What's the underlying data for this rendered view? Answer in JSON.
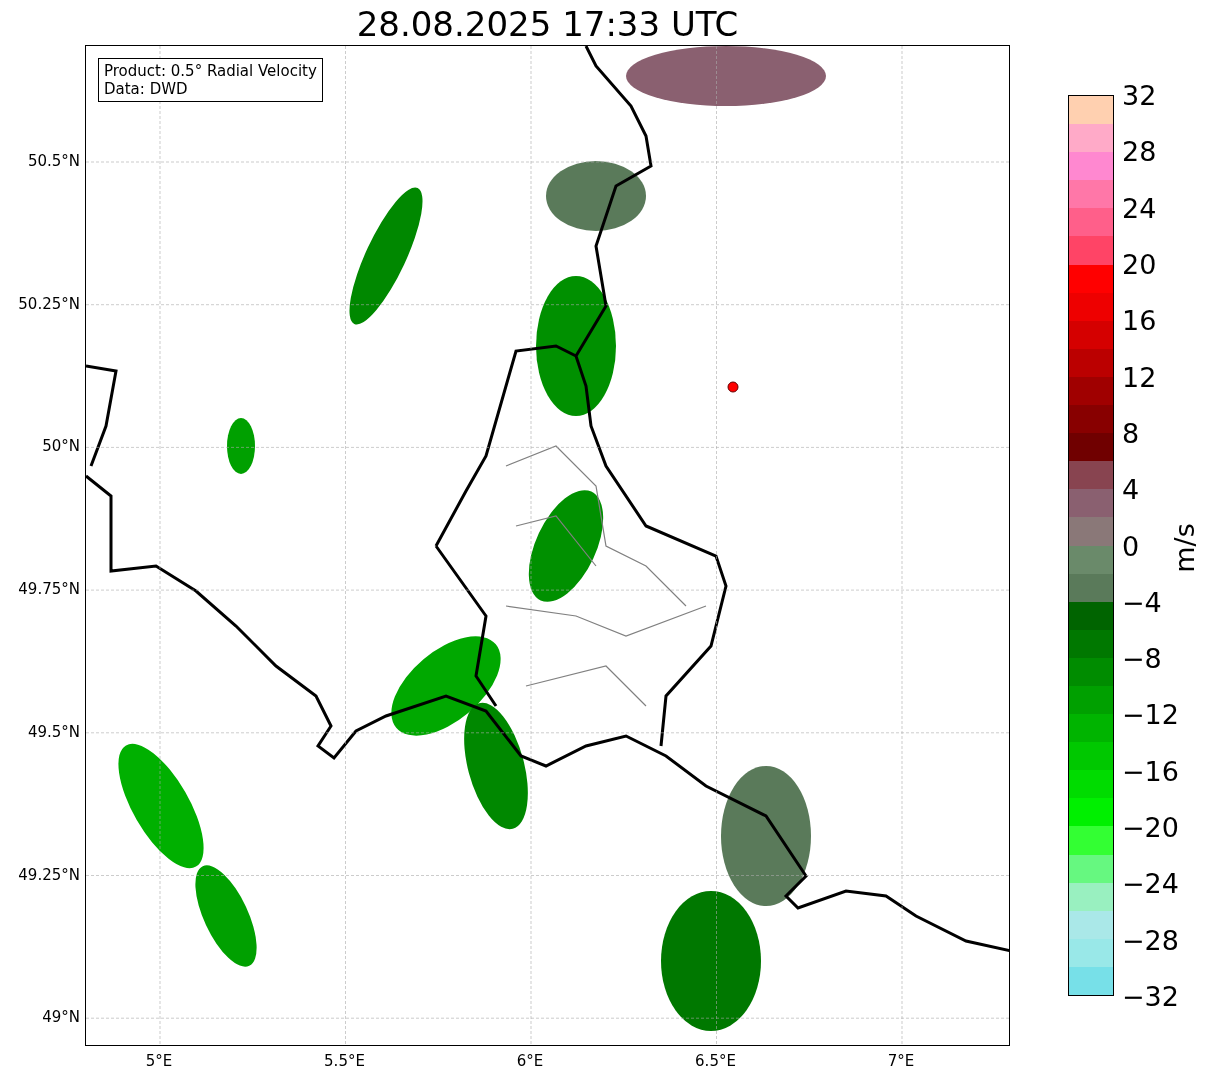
{
  "title": "28.08.2025 17:33 UTC",
  "info_box": {
    "lines": [
      "Product: 0.5° Radial Velocity",
      "Data: DWD"
    ]
  },
  "map": {
    "xticks": [
      "5°E",
      "5.5°E",
      "6°E",
      "6.5°E",
      "7°E"
    ],
    "yticks": [
      "50.5°N",
      "50.25°N",
      "50°N",
      "49.75°N",
      "49.5°N",
      "49.25°N",
      "49°N"
    ]
  },
  "colorbar": {
    "label": "m/s",
    "ticks": [
      "32",
      "28",
      "24",
      "20",
      "16",
      "12",
      "8",
      "4",
      "0",
      "−4",
      "−8",
      "−12",
      "−16",
      "−20",
      "−24",
      "−28",
      "−32"
    ],
    "segments": [
      {
        "color": "#ffd0b0"
      },
      {
        "color": "#ffaac8"
      },
      {
        "color": "#ff88d0"
      },
      {
        "color": "#ff77a8"
      },
      {
        "color": "#ff5f8a"
      },
      {
        "color": "#ff4466"
      },
      {
        "color": "#ff0000"
      },
      {
        "color": "#ee0000"
      },
      {
        "color": "#d50000"
      },
      {
        "color": "#bb0000"
      },
      {
        "color": "#a00000"
      },
      {
        "color": "#880000"
      },
      {
        "color": "#700000"
      },
      {
        "color": "#884450"
      },
      {
        "color": "#8a6070"
      },
      {
        "color": "#8a7878"
      },
      {
        "color": "#6a8a6a"
      },
      {
        "color": "#5a7a5a"
      },
      {
        "color": "#006400"
      },
      {
        "color": "#007800"
      },
      {
        "color": "#008c00"
      },
      {
        "color": "#00a000"
      },
      {
        "color": "#00b400"
      },
      {
        "color": "#00c800"
      },
      {
        "color": "#00dc00"
      },
      {
        "color": "#00f000"
      },
      {
        "color": "#33ff33"
      },
      {
        "color": "#66f880"
      },
      {
        "color": "#99f0c0"
      },
      {
        "color": "#aae8e8"
      },
      {
        "color": "#99e8e8"
      },
      {
        "color": "#77e0e8"
      }
    ]
  }
}
